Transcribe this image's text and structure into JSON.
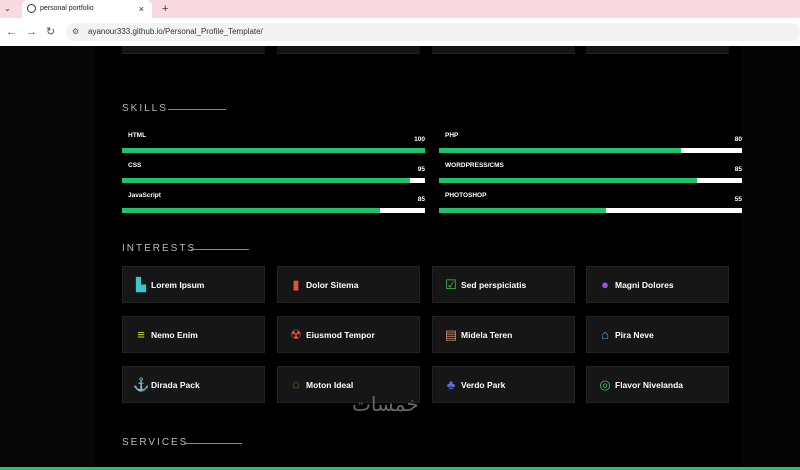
{
  "browser": {
    "tab_title": "personal portfolio",
    "tab_close": "×",
    "new_tab": "+",
    "url": "ayanour333.github.io/Personal_Profile_Template/"
  },
  "skills": {
    "title": "SKILLS",
    "left": [
      {
        "label": "HTML",
        "percent": "100",
        "value": 100
      },
      {
        "label": "CSS",
        "percent": "95",
        "value": 95
      },
      {
        "label": "JavaScript",
        "percent": "85",
        "value": 85
      }
    ],
    "right": [
      {
        "label": "PHP",
        "percent": "80",
        "value": 80
      },
      {
        "label": "WORDPRESS/CMS",
        "percent": "85",
        "value": 85
      },
      {
        "label": "PHOTOSHOP",
        "percent": "55",
        "value": 55
      }
    ]
  },
  "interests": {
    "title": "INTERESTS",
    "items": [
      {
        "label": "Lorem Ipsum",
        "icon": "store-icon",
        "color": "#3ec6c6"
      },
      {
        "label": "Dolor Sitema",
        "icon": "bar-chart-icon",
        "color": "#e2523a"
      },
      {
        "label": "Sed perspiciatis",
        "icon": "calendar-check-icon",
        "color": "#3ec65e"
      },
      {
        "label": "Magni Dolores",
        "icon": "palette-icon",
        "color": "#a04ee2"
      },
      {
        "label": "Nemo Enim",
        "icon": "database-icon",
        "color": "#c8d83c"
      },
      {
        "label": "Eiusmod Tempor",
        "icon": "radiation-icon",
        "color": "#e2523a"
      },
      {
        "label": "Midela Teren",
        "icon": "document-icon",
        "color": "#c08a6a"
      },
      {
        "label": "Pira Neve",
        "icon": "home-icon",
        "color": "#4aa3e8"
      },
      {
        "label": "Dirada Pack",
        "icon": "anchor-icon",
        "color": "#3c5ce2"
      },
      {
        "label": "Moton Ideal",
        "icon": "chat-bubble-icon",
        "color": "#c8a83c"
      },
      {
        "label": "Verdo Park",
        "icon": "park-icon",
        "color": "#5a6ce2"
      },
      {
        "label": "Flavor Nivelanda",
        "icon": "fingerprint-icon",
        "color": "#3ec65e"
      }
    ]
  },
  "services": {
    "title": "SERVICES"
  },
  "watermark": "خمسات"
}
